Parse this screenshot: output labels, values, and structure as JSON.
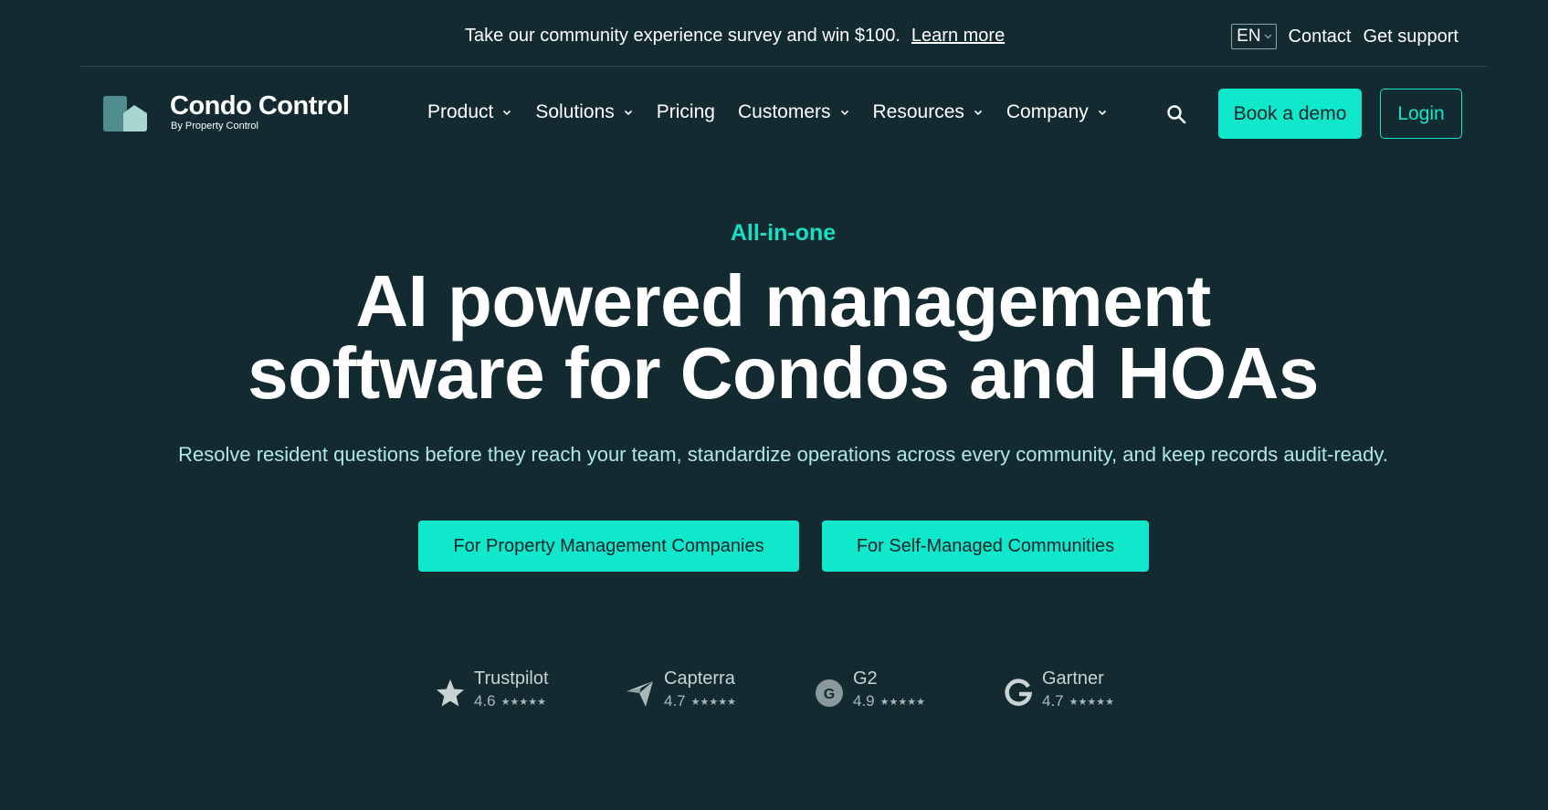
{
  "announcement": {
    "text": "Take our community experience survey and win $100.",
    "link": "Learn more"
  },
  "top_links": {
    "language": "EN",
    "contact": "Contact",
    "support": "Get support"
  },
  "logo": {
    "name": "Condo Control",
    "tagline": "By Property Control"
  },
  "nav": {
    "items": [
      {
        "label": "Product",
        "has_menu": true
      },
      {
        "label": "Solutions",
        "has_menu": true
      },
      {
        "label": "Pricing",
        "has_menu": false
      },
      {
        "label": "Customers",
        "has_menu": true
      },
      {
        "label": "Resources",
        "has_menu": true
      },
      {
        "label": "Company",
        "has_menu": true
      }
    ],
    "search_icon": "search-icon",
    "demo_button": "Book a demo",
    "login_button": "Login"
  },
  "hero": {
    "eyebrow": "All-in-one",
    "headline_line1": "AI powered management",
    "headline_line2": "software for Condos and HOAs",
    "subhead": "Resolve resident questions before they reach your team, standardize operations across every community, and keep records audit-ready.",
    "cta_primary": "For Property Management Companies",
    "cta_secondary": "For Self-Managed Communities"
  },
  "ratings": [
    {
      "name": "Trustpilot",
      "score": "4.6",
      "stars": 4.6,
      "icon": "trustpilot-star-icon"
    },
    {
      "name": "Capterra",
      "score": "4.7",
      "stars": 4.7,
      "icon": "capterra-icon"
    },
    {
      "name": "G2",
      "score": "4.9",
      "stars": 4.9,
      "icon": "g2-icon"
    },
    {
      "name": "Gartner",
      "score": "4.7",
      "stars": 4.7,
      "icon": "gartner-g-icon"
    }
  ],
  "colors": {
    "background": "#132a30",
    "accent": "#10e8cc",
    "accent_text": "#18dfc4",
    "subhead_text": "#aee9e6"
  }
}
